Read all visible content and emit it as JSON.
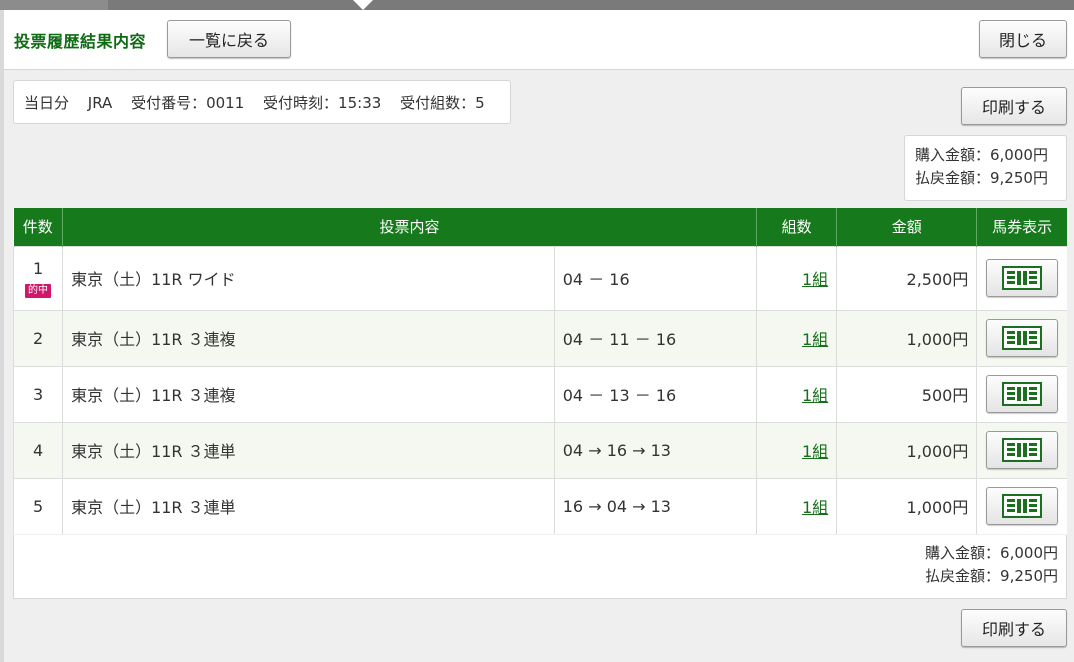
{
  "header": {
    "title": "投票履歴結果内容",
    "back_label": "一覧に戻る",
    "close_label": "閉じる"
  },
  "info": {
    "day": "当日分",
    "org": "JRA",
    "receipt_no": "受付番号：0011",
    "receipt_time": "受付時刻：15:33",
    "receipt_sets": "受付組数：5"
  },
  "print_label": "印刷する",
  "summary": {
    "purchase": "購入金額：6,000円",
    "refund": "払戻金額：9,250円"
  },
  "table": {
    "headers": [
      "件数",
      "投票内容",
      "組数",
      "金額",
      "馬券表示"
    ],
    "rows": [
      {
        "no": "1",
        "hit": "的中",
        "race": "東京（土）11R ワイド",
        "combo": "04 － 16",
        "sets": "1組",
        "amount": "2,500円"
      },
      {
        "no": "2",
        "race": "東京（土）11R ３連複",
        "combo": "04 － 11 － 16",
        "sets": "1組",
        "amount": "1,000円"
      },
      {
        "no": "3",
        "race": "東京（土）11R ３連複",
        "combo": "04 － 13 － 16",
        "sets": "1組",
        "amount": "500円"
      },
      {
        "no": "4",
        "race": "東京（土）11R ３連単",
        "combo": "04 → 16 → 13",
        "sets": "1組",
        "amount": "1,000円"
      },
      {
        "no": "5",
        "race": "東京（土）11R ３連単",
        "combo": "16 → 04 → 13",
        "sets": "1組",
        "amount": "1,000円"
      }
    ]
  },
  "icons": {
    "ticket": "ticket-icon"
  },
  "colors": {
    "accent_green": "#167a1c",
    "title_green": "#0e6b14",
    "hit_badge": "#d2176a"
  }
}
